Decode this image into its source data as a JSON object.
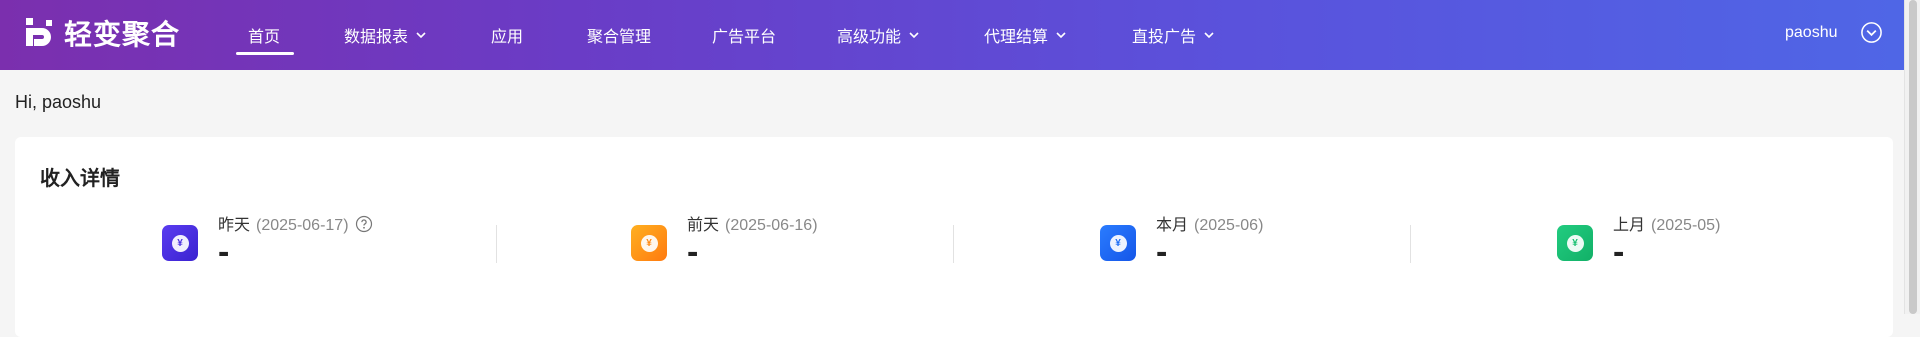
{
  "app": {
    "logo_text": "轻变聚合"
  },
  "nav": {
    "items": [
      {
        "label": "首页",
        "active": true,
        "dropdown": false
      },
      {
        "label": "数据报表",
        "active": false,
        "dropdown": true
      },
      {
        "label": "应用",
        "active": false,
        "dropdown": false
      },
      {
        "label": "聚合管理",
        "active": false,
        "dropdown": false
      },
      {
        "label": "广告平台",
        "active": false,
        "dropdown": false
      },
      {
        "label": "高级功能",
        "active": false,
        "dropdown": true
      },
      {
        "label": "代理结算",
        "active": false,
        "dropdown": true
      },
      {
        "label": "直投广告",
        "active": false,
        "dropdown": true
      }
    ],
    "user": "paoshu"
  },
  "greeting": "Hi, paoshu",
  "income": {
    "title": "收入详情",
    "stats": [
      {
        "label": "昨天",
        "date": "(2025-06-17)",
        "value": "-",
        "icon": "coin-icon",
        "color": "#4a2fe0",
        "has_help": true
      },
      {
        "label": "前天",
        "date": "(2025-06-16)",
        "value": "-",
        "icon": "coin-icon",
        "color": "#ff8a14",
        "has_help": false
      },
      {
        "label": "本月",
        "date": "(2025-06)",
        "value": "-",
        "icon": "coin-icon",
        "color": "#1d6df5",
        "has_help": false
      },
      {
        "label": "上月",
        "date": "(2025-05)",
        "value": "-",
        "icon": "coin-icon",
        "color": "#19c072",
        "has_help": false
      }
    ]
  },
  "colors": {
    "nav_gradient_start": "#7b2fae",
    "nav_gradient_end": "#4f66e6",
    "page_bg": "#f5f5f5"
  }
}
